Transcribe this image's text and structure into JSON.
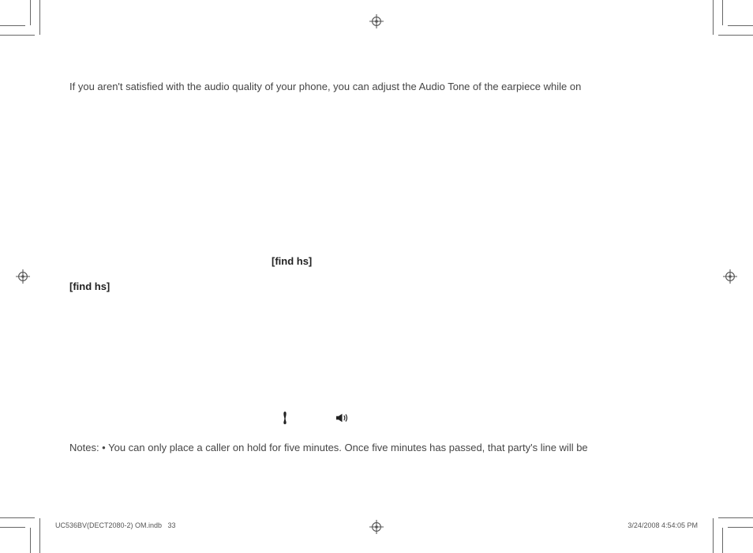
{
  "body": {
    "intro": "If you aren't satisfied with the audio quality of your phone, you can adjust the Audio Tone of the earpiece while on",
    "find_hs_1": "[find hs]",
    "find_hs_2": "[find hs]",
    "notes": "Notes: • You can only place a caller on hold for five minutes. Once five minutes has passed, that party's line will be"
  },
  "footer": {
    "doc": "UC536BV(DECT2080-2) OM.indb   33",
    "timestamp": "3/24/2008   4:54:05 PM"
  }
}
